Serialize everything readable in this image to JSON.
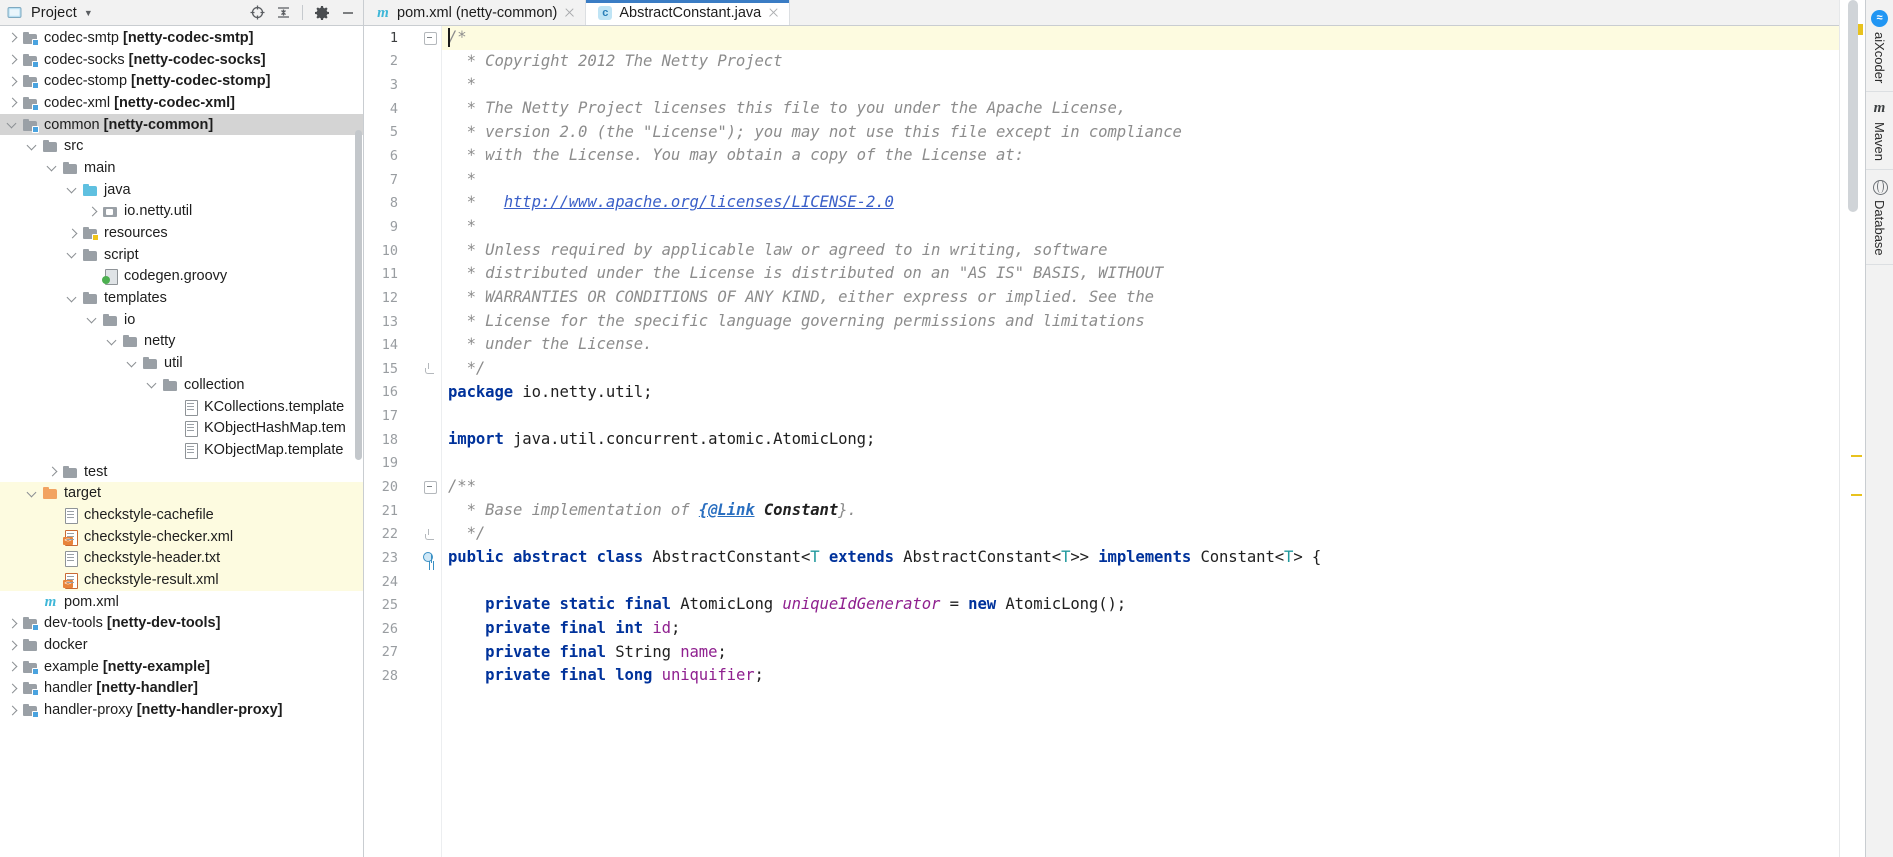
{
  "window": {
    "app": "IntelliJ IDEA",
    "accent_blue": "#3a7cc4",
    "current_line_highlight": "#fdfbe0",
    "selection_gray": "#d4d4d4"
  },
  "project_panel": {
    "title": "Project",
    "dropdown_icon": "chevron-down-icon",
    "toolbar": [
      {
        "name": "locate-icon",
        "glyph": "⊕"
      },
      {
        "name": "collapse-all-icon",
        "glyph": "⤓"
      },
      {
        "name": "settings-gear-icon",
        "glyph": "⚙"
      },
      {
        "name": "hide-panel-icon",
        "glyph": "—"
      }
    ],
    "tree": [
      {
        "indent": 1,
        "arrow": "closed",
        "icon": "folder-module",
        "label": "codec-smtp ",
        "bold": "[netty-codec-smtp]",
        "state": "normal"
      },
      {
        "indent": 1,
        "arrow": "closed",
        "icon": "folder-module",
        "label": "codec-socks ",
        "bold": "[netty-codec-socks]",
        "state": "normal"
      },
      {
        "indent": 1,
        "arrow": "closed",
        "icon": "folder-module",
        "label": "codec-stomp ",
        "bold": "[netty-codec-stomp]",
        "state": "normal"
      },
      {
        "indent": 1,
        "arrow": "closed",
        "icon": "folder-module",
        "label": "codec-xml ",
        "bold": "[netty-codec-xml]",
        "state": "normal"
      },
      {
        "indent": 1,
        "arrow": "open",
        "icon": "folder-module",
        "label": "common ",
        "bold": "[netty-common]",
        "state": "selected"
      },
      {
        "indent": 2,
        "arrow": "open",
        "icon": "folder",
        "label": "src",
        "bold": "",
        "state": "normal"
      },
      {
        "indent": 3,
        "arrow": "open",
        "icon": "folder",
        "label": "main",
        "bold": "",
        "state": "normal"
      },
      {
        "indent": 4,
        "arrow": "open",
        "icon": "folder-source",
        "label": "java",
        "bold": "",
        "state": "normal"
      },
      {
        "indent": 5,
        "arrow": "closed",
        "icon": "package",
        "label": "io.netty.util",
        "bold": "",
        "state": "normal"
      },
      {
        "indent": 4,
        "arrow": "closed",
        "icon": "folder-resources",
        "label": "resources",
        "bold": "",
        "state": "normal"
      },
      {
        "indent": 4,
        "arrow": "open",
        "icon": "folder",
        "label": "script",
        "bold": "",
        "state": "normal"
      },
      {
        "indent": 5,
        "arrow": "none",
        "icon": "groovy-file",
        "label": "codegen.groovy",
        "bold": "",
        "state": "normal"
      },
      {
        "indent": 4,
        "arrow": "open",
        "icon": "folder",
        "label": "templates",
        "bold": "",
        "state": "normal"
      },
      {
        "indent": 5,
        "arrow": "open",
        "icon": "folder",
        "label": "io",
        "bold": "",
        "state": "normal"
      },
      {
        "indent": 6,
        "arrow": "open",
        "icon": "folder",
        "label": "netty",
        "bold": "",
        "state": "normal"
      },
      {
        "indent": 7,
        "arrow": "open",
        "icon": "folder",
        "label": "util",
        "bold": "",
        "state": "normal"
      },
      {
        "indent": 8,
        "arrow": "open",
        "icon": "folder",
        "label": "collection",
        "bold": "",
        "state": "normal"
      },
      {
        "indent": 9,
        "arrow": "none",
        "icon": "text-file",
        "label": "KCollections.template",
        "bold": "",
        "state": "normal"
      },
      {
        "indent": 9,
        "arrow": "none",
        "icon": "text-file",
        "label": "KObjectHashMap.tem",
        "bold": "",
        "state": "normal"
      },
      {
        "indent": 9,
        "arrow": "none",
        "icon": "text-file",
        "label": "KObjectMap.template",
        "bold": "",
        "state": "normal"
      },
      {
        "indent": 3,
        "arrow": "closed",
        "icon": "folder",
        "label": "test",
        "bold": "",
        "state": "normal"
      },
      {
        "indent": 2,
        "arrow": "open",
        "icon": "folder-excluded",
        "label": "target",
        "bold": "",
        "state": "highlighted"
      },
      {
        "indent": 3,
        "arrow": "none",
        "icon": "text-file",
        "label": "checkstyle-cachefile",
        "bold": "",
        "state": "highlighted"
      },
      {
        "indent": 3,
        "arrow": "none",
        "icon": "xml-file",
        "label": "checkstyle-checker.xml",
        "bold": "",
        "state": "highlighted"
      },
      {
        "indent": 3,
        "arrow": "none",
        "icon": "text-file",
        "label": "checkstyle-header.txt",
        "bold": "",
        "state": "highlighted"
      },
      {
        "indent": 3,
        "arrow": "none",
        "icon": "xml-file",
        "label": "checkstyle-result.xml",
        "bold": "",
        "state": "highlighted"
      },
      {
        "indent": 2,
        "arrow": "none",
        "icon": "maven-file",
        "label": "pom.xml",
        "bold": "",
        "state": "normal"
      },
      {
        "indent": 1,
        "arrow": "closed",
        "icon": "folder-module",
        "label": "dev-tools ",
        "bold": "[netty-dev-tools]",
        "state": "normal"
      },
      {
        "indent": 1,
        "arrow": "closed",
        "icon": "folder",
        "label": "docker",
        "bold": "",
        "state": "normal"
      },
      {
        "indent": 1,
        "arrow": "closed",
        "icon": "folder-module",
        "label": "example ",
        "bold": "[netty-example]",
        "state": "normal"
      },
      {
        "indent": 1,
        "arrow": "closed",
        "icon": "folder-module",
        "label": "handler ",
        "bold": "[netty-handler]",
        "state": "normal"
      },
      {
        "indent": 1,
        "arrow": "closed",
        "icon": "folder-module",
        "label": "handler-proxy ",
        "bold": "[netty-handler-proxy]",
        "state": "normal"
      }
    ]
  },
  "tabs": [
    {
      "label": "pom.xml (netty-common)",
      "icon": "maven-file-icon",
      "active": false,
      "closable": true
    },
    {
      "label": "AbstractConstant.java",
      "icon": "java-class-icon",
      "active": true,
      "closable": true
    }
  ],
  "editor": {
    "file": "AbstractConstant.java",
    "first_line": 1,
    "caret_line": 1,
    "lines": [
      {
        "n": 1,
        "fold": "minus",
        "mark": "",
        "cur": true,
        "tokens": [
          {
            "c": "c-com",
            "t": "/*"
          }
        ]
      },
      {
        "n": 2,
        "fold": "",
        "mark": "",
        "cur": false,
        "tokens": [
          {
            "c": "c-com",
            "t": "  * Copyright 2012 The Netty Project"
          }
        ]
      },
      {
        "n": 3,
        "fold": "",
        "mark": "",
        "cur": false,
        "tokens": [
          {
            "c": "c-com",
            "t": "  *"
          }
        ]
      },
      {
        "n": 4,
        "fold": "",
        "mark": "",
        "cur": false,
        "tokens": [
          {
            "c": "c-com",
            "t": "  * The Netty Project licenses this file to you under the Apache License,"
          }
        ]
      },
      {
        "n": 5,
        "fold": "",
        "mark": "",
        "cur": false,
        "tokens": [
          {
            "c": "c-com",
            "t": "  * version 2.0 (the \"License\"); you may not use this file except in compliance"
          }
        ]
      },
      {
        "n": 6,
        "fold": "",
        "mark": "",
        "cur": false,
        "tokens": [
          {
            "c": "c-com",
            "t": "  * with the License. You may obtain a copy of the License at:"
          }
        ]
      },
      {
        "n": 7,
        "fold": "",
        "mark": "",
        "cur": false,
        "tokens": [
          {
            "c": "c-com",
            "t": "  *"
          }
        ]
      },
      {
        "n": 8,
        "fold": "",
        "mark": "",
        "cur": false,
        "tokens": [
          {
            "c": "c-com",
            "t": "  *   "
          },
          {
            "c": "c-link",
            "t": "http://www.apache.org/licenses/LICENSE-2.0"
          }
        ]
      },
      {
        "n": 9,
        "fold": "",
        "mark": "",
        "cur": false,
        "tokens": [
          {
            "c": "c-com",
            "t": "  *"
          }
        ]
      },
      {
        "n": 10,
        "fold": "",
        "mark": "",
        "cur": false,
        "tokens": [
          {
            "c": "c-com",
            "t": "  * Unless required by applicable law or agreed to in writing, software"
          }
        ]
      },
      {
        "n": 11,
        "fold": "",
        "mark": "",
        "cur": false,
        "tokens": [
          {
            "c": "c-com",
            "t": "  * distributed under the License is distributed on an \"AS IS\" BASIS, WITHOUT"
          }
        ]
      },
      {
        "n": 12,
        "fold": "",
        "mark": "",
        "cur": false,
        "tokens": [
          {
            "c": "c-com",
            "t": "  * WARRANTIES OR CONDITIONS OF ANY KIND, either express or implied. See the"
          }
        ]
      },
      {
        "n": 13,
        "fold": "",
        "mark": "",
        "cur": false,
        "tokens": [
          {
            "c": "c-com",
            "t": "  * License for the specific language governing permissions and limitations"
          }
        ]
      },
      {
        "n": 14,
        "fold": "",
        "mark": "",
        "cur": false,
        "tokens": [
          {
            "c": "c-com",
            "t": "  * under the License."
          }
        ]
      },
      {
        "n": 15,
        "fold": "endtop",
        "mark": "",
        "cur": false,
        "tokens": [
          {
            "c": "c-com",
            "t": "  */"
          }
        ]
      },
      {
        "n": 16,
        "fold": "",
        "mark": "",
        "cur": false,
        "tokens": [
          {
            "c": "c-kw",
            "t": "package"
          },
          {
            "c": "c-txt",
            "t": " io.netty.util;"
          }
        ]
      },
      {
        "n": 17,
        "fold": "",
        "mark": "",
        "cur": false,
        "tokens": []
      },
      {
        "n": 18,
        "fold": "",
        "mark": "",
        "cur": false,
        "tokens": [
          {
            "c": "c-kw",
            "t": "import"
          },
          {
            "c": "c-txt",
            "t": " java.util.concurrent.atomic.AtomicLong;"
          }
        ]
      },
      {
        "n": 19,
        "fold": "",
        "mark": "",
        "cur": false,
        "tokens": []
      },
      {
        "n": 20,
        "fold": "minus",
        "mark": "",
        "cur": false,
        "tokens": [
          {
            "c": "c-com",
            "t": "/**"
          }
        ]
      },
      {
        "n": 21,
        "fold": "",
        "mark": "",
        "cur": false,
        "tokens": [
          {
            "c": "c-com",
            "t": "  * Base implementation of "
          },
          {
            "c": "c-tag",
            "t": "{@Link"
          },
          {
            "c": "c-com",
            "t": " "
          },
          {
            "c": "c-doctype",
            "t": "Constant"
          },
          {
            "c": "c-com",
            "t": "}."
          }
        ]
      },
      {
        "n": 22,
        "fold": "endtop",
        "mark": "",
        "cur": false,
        "tokens": [
          {
            "c": "c-com",
            "t": "  */"
          }
        ]
      },
      {
        "n": 23,
        "fold": "",
        "mark": "class",
        "cur": false,
        "tokens": [
          {
            "c": "c-kw",
            "t": "public abstract class"
          },
          {
            "c": "c-txt",
            "t": " AbstractConstant<"
          },
          {
            "c": "c-type",
            "t": "T"
          },
          {
            "c": "c-txt",
            "t": " "
          },
          {
            "c": "c-kw",
            "t": "extends"
          },
          {
            "c": "c-txt",
            "t": " AbstractConstant<"
          },
          {
            "c": "c-type",
            "t": "T"
          },
          {
            "c": "c-txt",
            "t": ">> "
          },
          {
            "c": "c-kw",
            "t": "implements"
          },
          {
            "c": "c-txt",
            "t": " Constant<"
          },
          {
            "c": "c-type",
            "t": "T"
          },
          {
            "c": "c-txt",
            "t": "> {"
          }
        ]
      },
      {
        "n": 24,
        "fold": "",
        "mark": "",
        "cur": false,
        "tokens": []
      },
      {
        "n": 25,
        "fold": "",
        "mark": "",
        "cur": false,
        "tokens": [
          {
            "c": "c-txt",
            "t": "    "
          },
          {
            "c": "c-kw",
            "t": "private static final"
          },
          {
            "c": "c-txt",
            "t": " AtomicLong "
          },
          {
            "c": "c-sfield",
            "t": "uniqueIdGenerator"
          },
          {
            "c": "c-txt",
            "t": " = "
          },
          {
            "c": "c-kw",
            "t": "new"
          },
          {
            "c": "c-txt",
            "t": " AtomicLong();"
          }
        ]
      },
      {
        "n": 26,
        "fold": "",
        "mark": "",
        "cur": false,
        "tokens": [
          {
            "c": "c-txt",
            "t": "    "
          },
          {
            "c": "c-kw",
            "t": "private final int"
          },
          {
            "c": "c-txt",
            "t": " "
          },
          {
            "c": "c-field",
            "t": "id"
          },
          {
            "c": "c-txt",
            "t": ";"
          }
        ]
      },
      {
        "n": 27,
        "fold": "",
        "mark": "",
        "cur": false,
        "tokens": [
          {
            "c": "c-txt",
            "t": "    "
          },
          {
            "c": "c-kw",
            "t": "private final"
          },
          {
            "c": "c-txt",
            "t": " String "
          },
          {
            "c": "c-field",
            "t": "name"
          },
          {
            "c": "c-txt",
            "t": ";"
          }
        ]
      },
      {
        "n": 28,
        "fold": "",
        "mark": "",
        "cur": false,
        "tokens": [
          {
            "c": "c-txt",
            "t": "    "
          },
          {
            "c": "c-kw",
            "t": "private final long"
          },
          {
            "c": "c-txt",
            "t": " "
          },
          {
            "c": "c-field",
            "t": "uniquifier"
          },
          {
            "c": "c-txt",
            "t": ";"
          }
        ]
      }
    ]
  },
  "right_bar": {
    "tabs": [
      {
        "label": "aiXcoder",
        "icon": "aixcoder-icon"
      },
      {
        "label": "Maven",
        "icon": "maven-icon"
      },
      {
        "label": "Database",
        "icon": "database-icon"
      }
    ]
  },
  "scrollbar": {
    "warning_marker_color": "#e8c21e",
    "thumb_color": "#d0d4d8"
  }
}
